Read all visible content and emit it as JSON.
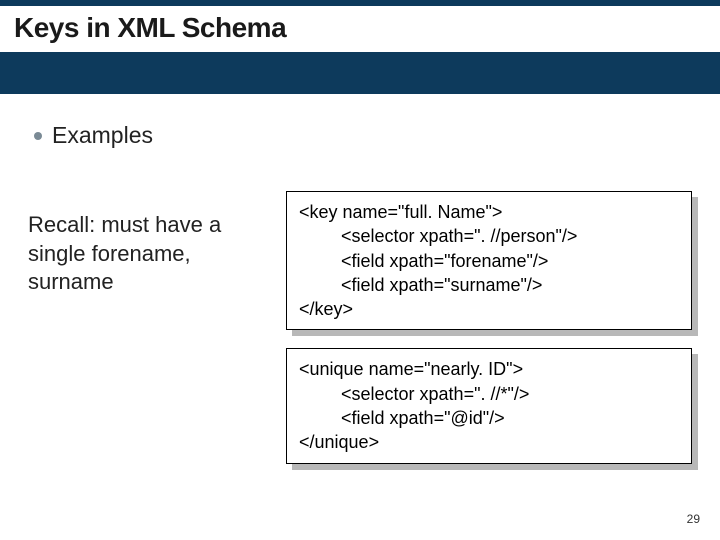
{
  "title": "Keys in XML Schema",
  "bullet": "Examples",
  "recall": "Recall: must have a single forename, surname",
  "code1": {
    "l1": "<key name=\"full. Name\">",
    "l2": "<selector xpath=\". //person\"/>",
    "l3": "<field xpath=\"forename\"/>",
    "l4": "<field xpath=\"surname\"/>",
    "l5": "</key>"
  },
  "code2": {
    "l1": "<unique name=\"nearly. ID\">",
    "l2": "<selector xpath=\". //*\"/>",
    "l3": "<field xpath=\"@id\"/>",
    "l4": "</unique>"
  },
  "page_number": "29"
}
